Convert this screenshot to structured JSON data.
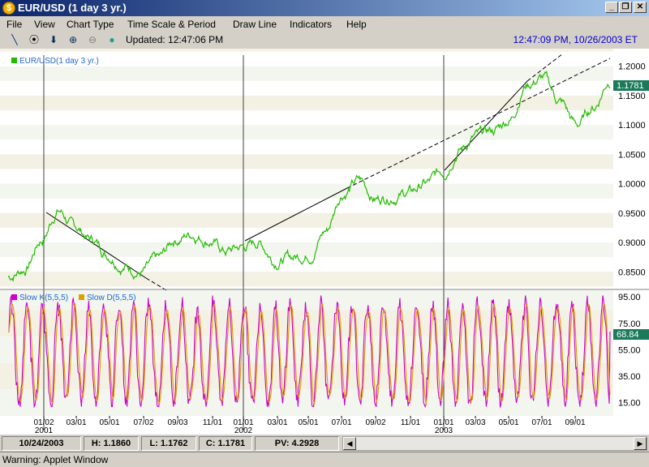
{
  "window": {
    "title": "EUR/USD (1 day  3 yr.)",
    "app_icon_glyph": "$"
  },
  "menu": [
    "File",
    "View",
    "Chart Type",
    "Time Scale & Period",
    "Draw Line",
    "Indicators",
    "Help"
  ],
  "toolbar": {
    "icons": [
      "pencil-icon",
      "target-icon",
      "down-arrow-icon",
      "zoom-in-icon",
      "zoom-out-icon",
      "color-ball-icon"
    ],
    "updated": "Updated: 12:47:06 PM",
    "clock": "12:47:09 PM, 10/26/2003 ET"
  },
  "price_panel": {
    "legend": "EUR/USD(1 day  3 yr.)",
    "line_color": "#22bb00",
    "last_value": "1.1781",
    "y_ticks": [
      "1.2000",
      "1.1500",
      "1.1000",
      "1.0500",
      "1.0000",
      "0.9500",
      "0.9000",
      "0.8500"
    ]
  },
  "stoch_panel": {
    "legend_k": "Slow K(5,5,5)",
    "legend_d": "Slow D(5,5,5)",
    "k_color": "#cc00cc",
    "d_color": "#e0a000",
    "last_value": "68.84",
    "y_ticks": [
      "95.00",
      "75.00",
      "55.00",
      "35.00",
      "15.00"
    ]
  },
  "x_axis": {
    "labels": [
      "01/02",
      "03/01",
      "05/01",
      "07/02",
      "09/03",
      "11/01",
      "01/01",
      "03/01",
      "05/01",
      "07/01",
      "09/02",
      "11/01",
      "01/01",
      "03/03",
      "05/01",
      "07/01",
      "09/01"
    ],
    "years": [
      "2001",
      "2002",
      "2003"
    ]
  },
  "chart_data": {
    "type": "line",
    "title": "EUR/USD(1 day  3 yr.)",
    "series": [
      {
        "name": "EUR/USD(1 day  3 yr.)",
        "x": [
          "2000-10",
          "2000-11",
          "2000-12",
          "2001-01",
          "2001-02",
          "2001-03",
          "2001-04",
          "2001-05",
          "2001-06",
          "2001-07",
          "2001-08",
          "2001-09",
          "2001-10",
          "2001-11",
          "2001-12",
          "2002-01",
          "2002-02",
          "2002-03",
          "2002-04",
          "2002-05",
          "2002-06",
          "2002-07",
          "2002-08",
          "2002-09",
          "2002-10",
          "2002-11",
          "2002-12",
          "2003-01",
          "2003-02",
          "2003-03",
          "2003-04",
          "2003-05",
          "2003-06",
          "2003-07",
          "2003-08",
          "2003-09",
          "2003-10"
        ],
        "values": [
          0.842,
          0.855,
          0.905,
          0.955,
          0.925,
          0.905,
          0.88,
          0.86,
          0.85,
          0.87,
          0.905,
          0.915,
          0.905,
          0.885,
          0.892,
          0.9,
          0.87,
          0.875,
          0.88,
          0.92,
          0.985,
          1.005,
          0.975,
          0.98,
          0.985,
          1.0,
          1.02,
          1.06,
          1.08,
          1.09,
          1.11,
          1.17,
          1.18,
          1.14,
          1.1,
          1.13,
          1.1781
        ]
      }
    ],
    "stochastics": {
      "k_name": "Slow K(5,5,5)",
      "d_name": "Slow D(5,5,5)",
      "last": 68.84,
      "ylim": [
        5,
        100
      ]
    },
    "ylim": [
      0.82,
      1.23
    ],
    "grid": true,
    "legend": "top-left"
  }
}
